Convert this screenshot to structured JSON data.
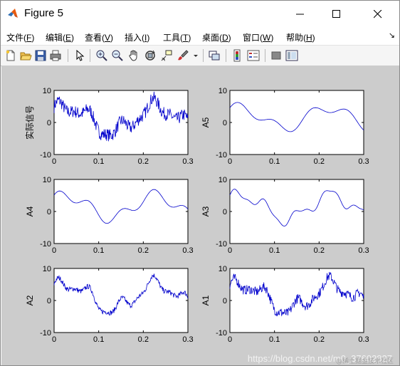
{
  "window": {
    "title": "Figure 5",
    "controls": {
      "minimize": "minimize-button",
      "maximize": "maximize-button",
      "close": "close-button"
    }
  },
  "menu": {
    "items": [
      {
        "label": "文件(",
        "key": "F",
        "end": ")"
      },
      {
        "label": "编辑(",
        "key": "E",
        "end": ")"
      },
      {
        "label": "查看(",
        "key": "V",
        "end": ")"
      },
      {
        "label": "插入(",
        "key": "I",
        "end": ")"
      },
      {
        "label": "工具(",
        "key": "T",
        "end": ")"
      },
      {
        "label": "桌面(",
        "key": "D",
        "end": ")"
      },
      {
        "label": "窗口(",
        "key": "W",
        "end": ")"
      },
      {
        "label": "帮助(",
        "key": "H",
        "end": ")"
      }
    ],
    "overflow": "↘"
  },
  "toolbar": {
    "icons": [
      "new-figure-icon",
      "open-file-icon",
      "save-icon",
      "print-icon",
      "edit-plot-arrow-icon",
      "zoom-in-icon",
      "zoom-out-icon",
      "pan-hand-icon",
      "rotate-3d-icon",
      "data-cursor-icon",
      "brush-icon",
      "link-plot-icon",
      "insert-colorbar-icon",
      "insert-legend-icon",
      "hide-plot-tools-icon",
      "show-plot-tools-icon"
    ]
  },
  "chart_data": [
    {
      "type": "line",
      "ylabel": "实际信号",
      "xlim": [
        0,
        0.3
      ],
      "ylim": [
        -10,
        10
      ],
      "xticks": [
        "0",
        "0.1",
        "0.2",
        "0.3"
      ],
      "yticks": [
        "10",
        "0",
        "-10"
      ],
      "color": "#0000cc",
      "signal": "noisy"
    },
    {
      "type": "line",
      "ylabel": "A5",
      "xlim": [
        0,
        0.3
      ],
      "ylim": [
        -10,
        10
      ],
      "xticks": [
        "0",
        "0.1",
        "0.2",
        "0.3"
      ],
      "yticks": [
        "10",
        "0",
        "-10"
      ],
      "color": "#0000cc",
      "signal": "smooth"
    },
    {
      "type": "line",
      "ylabel": "A4",
      "xlim": [
        0,
        0.3
      ],
      "ylim": [
        -10,
        10
      ],
      "xticks": [
        "0",
        "0.1",
        "0.2",
        "0.3"
      ],
      "yticks": [
        "10",
        "0",
        "-10"
      ],
      "color": "#0000cc",
      "signal": "smooth2"
    },
    {
      "type": "line",
      "ylabel": "A3",
      "xlim": [
        0,
        0.3
      ],
      "ylim": [
        -10,
        10
      ],
      "xticks": [
        "0",
        "0.1",
        "0.2",
        "0.3"
      ],
      "yticks": [
        "10",
        "0",
        "-10"
      ],
      "color": "#0000cc",
      "signal": "smooth3"
    },
    {
      "type": "line",
      "ylabel": "A2",
      "xlim": [
        0,
        0.3
      ],
      "ylim": [
        -10,
        10
      ],
      "xticks": [
        "0",
        "0.1",
        "0.2",
        "0.3"
      ],
      "yticks": [
        "10",
        "0",
        "-10"
      ],
      "color": "#0000cc",
      "signal": "medium"
    },
    {
      "type": "line",
      "ylabel": "A1",
      "xlim": [
        0,
        0.3
      ],
      "ylim": [
        -10,
        10
      ],
      "xticks": [
        "0",
        "0.1",
        "0.2",
        "0.3"
      ],
      "yticks": [
        "10",
        "0",
        "-10"
      ],
      "color": "#0000cc",
      "signal": "noisy2"
    }
  ],
  "watermark": "https://blog.csdn.net/m0_37602827",
  "watermark2": "@稀土掘金技术社区"
}
